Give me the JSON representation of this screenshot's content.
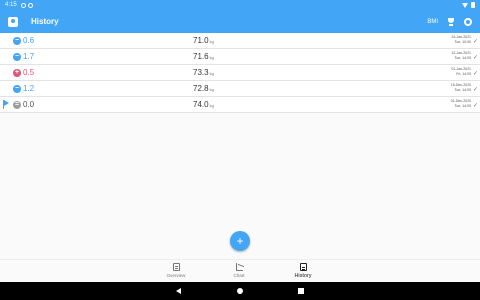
{
  "status_bar": {
    "time": "4:15"
  },
  "app_bar": {
    "title": "History",
    "bmi_label": "BMI"
  },
  "colors": {
    "accent": "#42a5f5",
    "gain": "#e05578",
    "neutral": "#9e9e9e"
  },
  "entries": [
    {
      "change": "0.6",
      "direction": "down",
      "weight": "71.0",
      "unit": "kg",
      "date": "24-Jan-2021",
      "day_time": "Tue, 10:00",
      "icon": "minus-badge-icon",
      "flagged": false
    },
    {
      "change": "1.7",
      "direction": "down",
      "weight": "71.6",
      "unit": "kg",
      "date": "12-Jan-2021",
      "day_time": "Tue, 14:09",
      "icon": "minus-badge-icon",
      "flagged": false
    },
    {
      "change": "0.5",
      "direction": "up",
      "weight": "73.3",
      "unit": "kg",
      "date": "01-Jan-2021",
      "day_time": "Fri, 14:09",
      "icon": "plus-badge-icon",
      "flagged": false
    },
    {
      "change": "1.2",
      "direction": "down",
      "weight": "72.8",
      "unit": "kg",
      "date": "15-Dec-2020",
      "day_time": "Tue, 14:09",
      "icon": "minus-badge-icon",
      "flagged": false
    },
    {
      "change": "0.0",
      "direction": "none",
      "weight": "74.0",
      "unit": "kg",
      "date": "01-Dec-2020",
      "day_time": "Tue, 14:09",
      "icon": "equal-badge-icon",
      "flagged": true
    }
  ],
  "fab": {
    "label": "+"
  },
  "bottom_nav": [
    {
      "label": "Overview",
      "icon": "overview-icon",
      "active": false
    },
    {
      "label": "Chart",
      "icon": "chart-icon",
      "active": false
    },
    {
      "label": "History",
      "icon": "history-icon",
      "active": true
    }
  ]
}
